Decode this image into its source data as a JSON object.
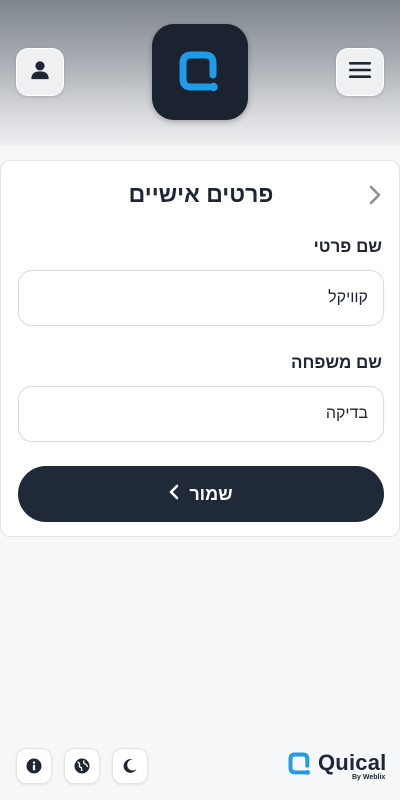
{
  "header": {
    "user_icon": "user-icon",
    "menu_icon": "hamburger-menu-icon",
    "logo_icon": "quical-logo"
  },
  "page": {
    "title": "פרטים אישיים",
    "back_icon": "chevron-right-icon"
  },
  "form": {
    "first_name_label": "שם פרטי",
    "first_name_value": "קוויקל",
    "last_name_label": "שם משפחה",
    "last_name_value": "בדיקה",
    "save_label": "שמור",
    "save_icon": "chevron-left-icon"
  },
  "footer": {
    "buttons": [
      "info-icon",
      "globe-icon",
      "moon-icon"
    ],
    "brand_name": "Quical",
    "brand_sub": "By Weblix"
  },
  "colors": {
    "primary": "#1f2937",
    "accent": "#1e9be9"
  }
}
